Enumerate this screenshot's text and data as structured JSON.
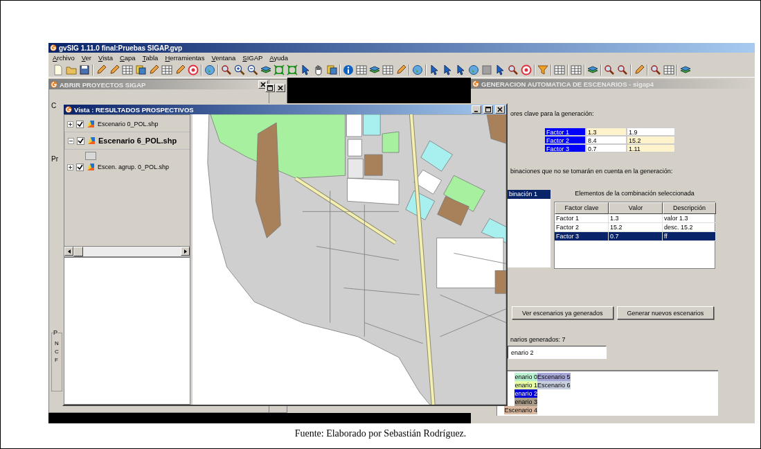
{
  "window": {
    "title": "gvSIG 1.11.0 final:Pruebas SIGAP.gvp"
  },
  "menu": [
    "Archivo",
    "Ver",
    "Vista",
    "Capa",
    "Tabla",
    "Herramientas",
    "Ventana",
    "SIGAP",
    "Ayuda"
  ],
  "abrir_window": {
    "title": "ABRIR PROYECTOS SIGAP",
    "active": false,
    "fragments": [
      "C",
      "Pr"
    ],
    "group": {
      "legend": "P",
      "lines": [
        "N",
        "C",
        "F"
      ]
    }
  },
  "vista_window": {
    "title": "Vista : RESULTADOS PROSPECTIVOS",
    "active": true,
    "layers": [
      {
        "label": "Escenario 0_POL.shp",
        "checked": true,
        "expanded": false,
        "selected": false
      },
      {
        "label": "Escenario 6_POL.shp",
        "checked": true,
        "expanded": true,
        "selected": true
      },
      {
        "label": "Escen. agrup. 0_POL.shp",
        "checked": true,
        "expanded": false,
        "selected": false
      }
    ]
  },
  "generacion_window": {
    "title": "GENERACION AUTOMATICA DE ESCENARIOS - sigap4",
    "active": false,
    "intro_label": "ores clave para la generación:",
    "factors": [
      {
        "name": "Factor 1",
        "values": [
          {
            "text": "1.3",
            "highlighted": true
          },
          {
            "text": "1.9",
            "highlighted": false
          }
        ]
      },
      {
        "name": "Factor 2",
        "values": [
          {
            "text": "8.4",
            "highlighted": false
          },
          {
            "text": "15.2",
            "highlighted": true
          }
        ]
      },
      {
        "name": "Factor 3",
        "values": [
          {
            "text": "0.7",
            "highlighted": false
          },
          {
            "text": "1.11",
            "highlighted": true
          }
        ]
      }
    ],
    "exclusions_label": "binaciones que no se tomarán en cuenta en la generación:",
    "combinations": [
      {
        "label": "binación 1",
        "selected": true
      }
    ],
    "elements_title": "Elementos de la combinación seleccionada",
    "elements_table": {
      "columns": [
        "Factor clave",
        "Valor",
        "Descripción"
      ],
      "rows": [
        {
          "cells": [
            "Factor 1",
            "1.3",
            "valor 1.3"
          ],
          "selected": false
        },
        {
          "cells": [
            "Factor 2",
            "15.2",
            "desc. 15.2"
          ],
          "selected": false
        },
        {
          "cells": [
            "Factor 3",
            "0.7",
            "ff"
          ],
          "selected": true
        }
      ]
    },
    "buttons": [
      "Ver escenarios ya generados",
      "Generar nuevos escenarios"
    ],
    "count_label": "narios generados: 7",
    "scenario_field": {
      "value": "enario 2"
    },
    "scenario_columns": [
      [
        {
          "label": "enario 0",
          "color": "#b8f0d0"
        },
        {
          "label": "enario 1",
          "color": "#e8ffa8"
        },
        {
          "label": "enario 2",
          "color": "#0000d8"
        },
        {
          "label": "enario 3",
          "color": "#a89c88"
        },
        {
          "label": "Escenario 4",
          "color": "#d8b8a0"
        }
      ],
      [
        {
          "label": "Escenario 5",
          "color": "#a8a8d8"
        },
        {
          "label": "Escenario 6",
          "color": "#c8d0e0"
        }
      ]
    ]
  },
  "caption": "Fuente: Elaborado por Sebastián Rodríguez."
}
